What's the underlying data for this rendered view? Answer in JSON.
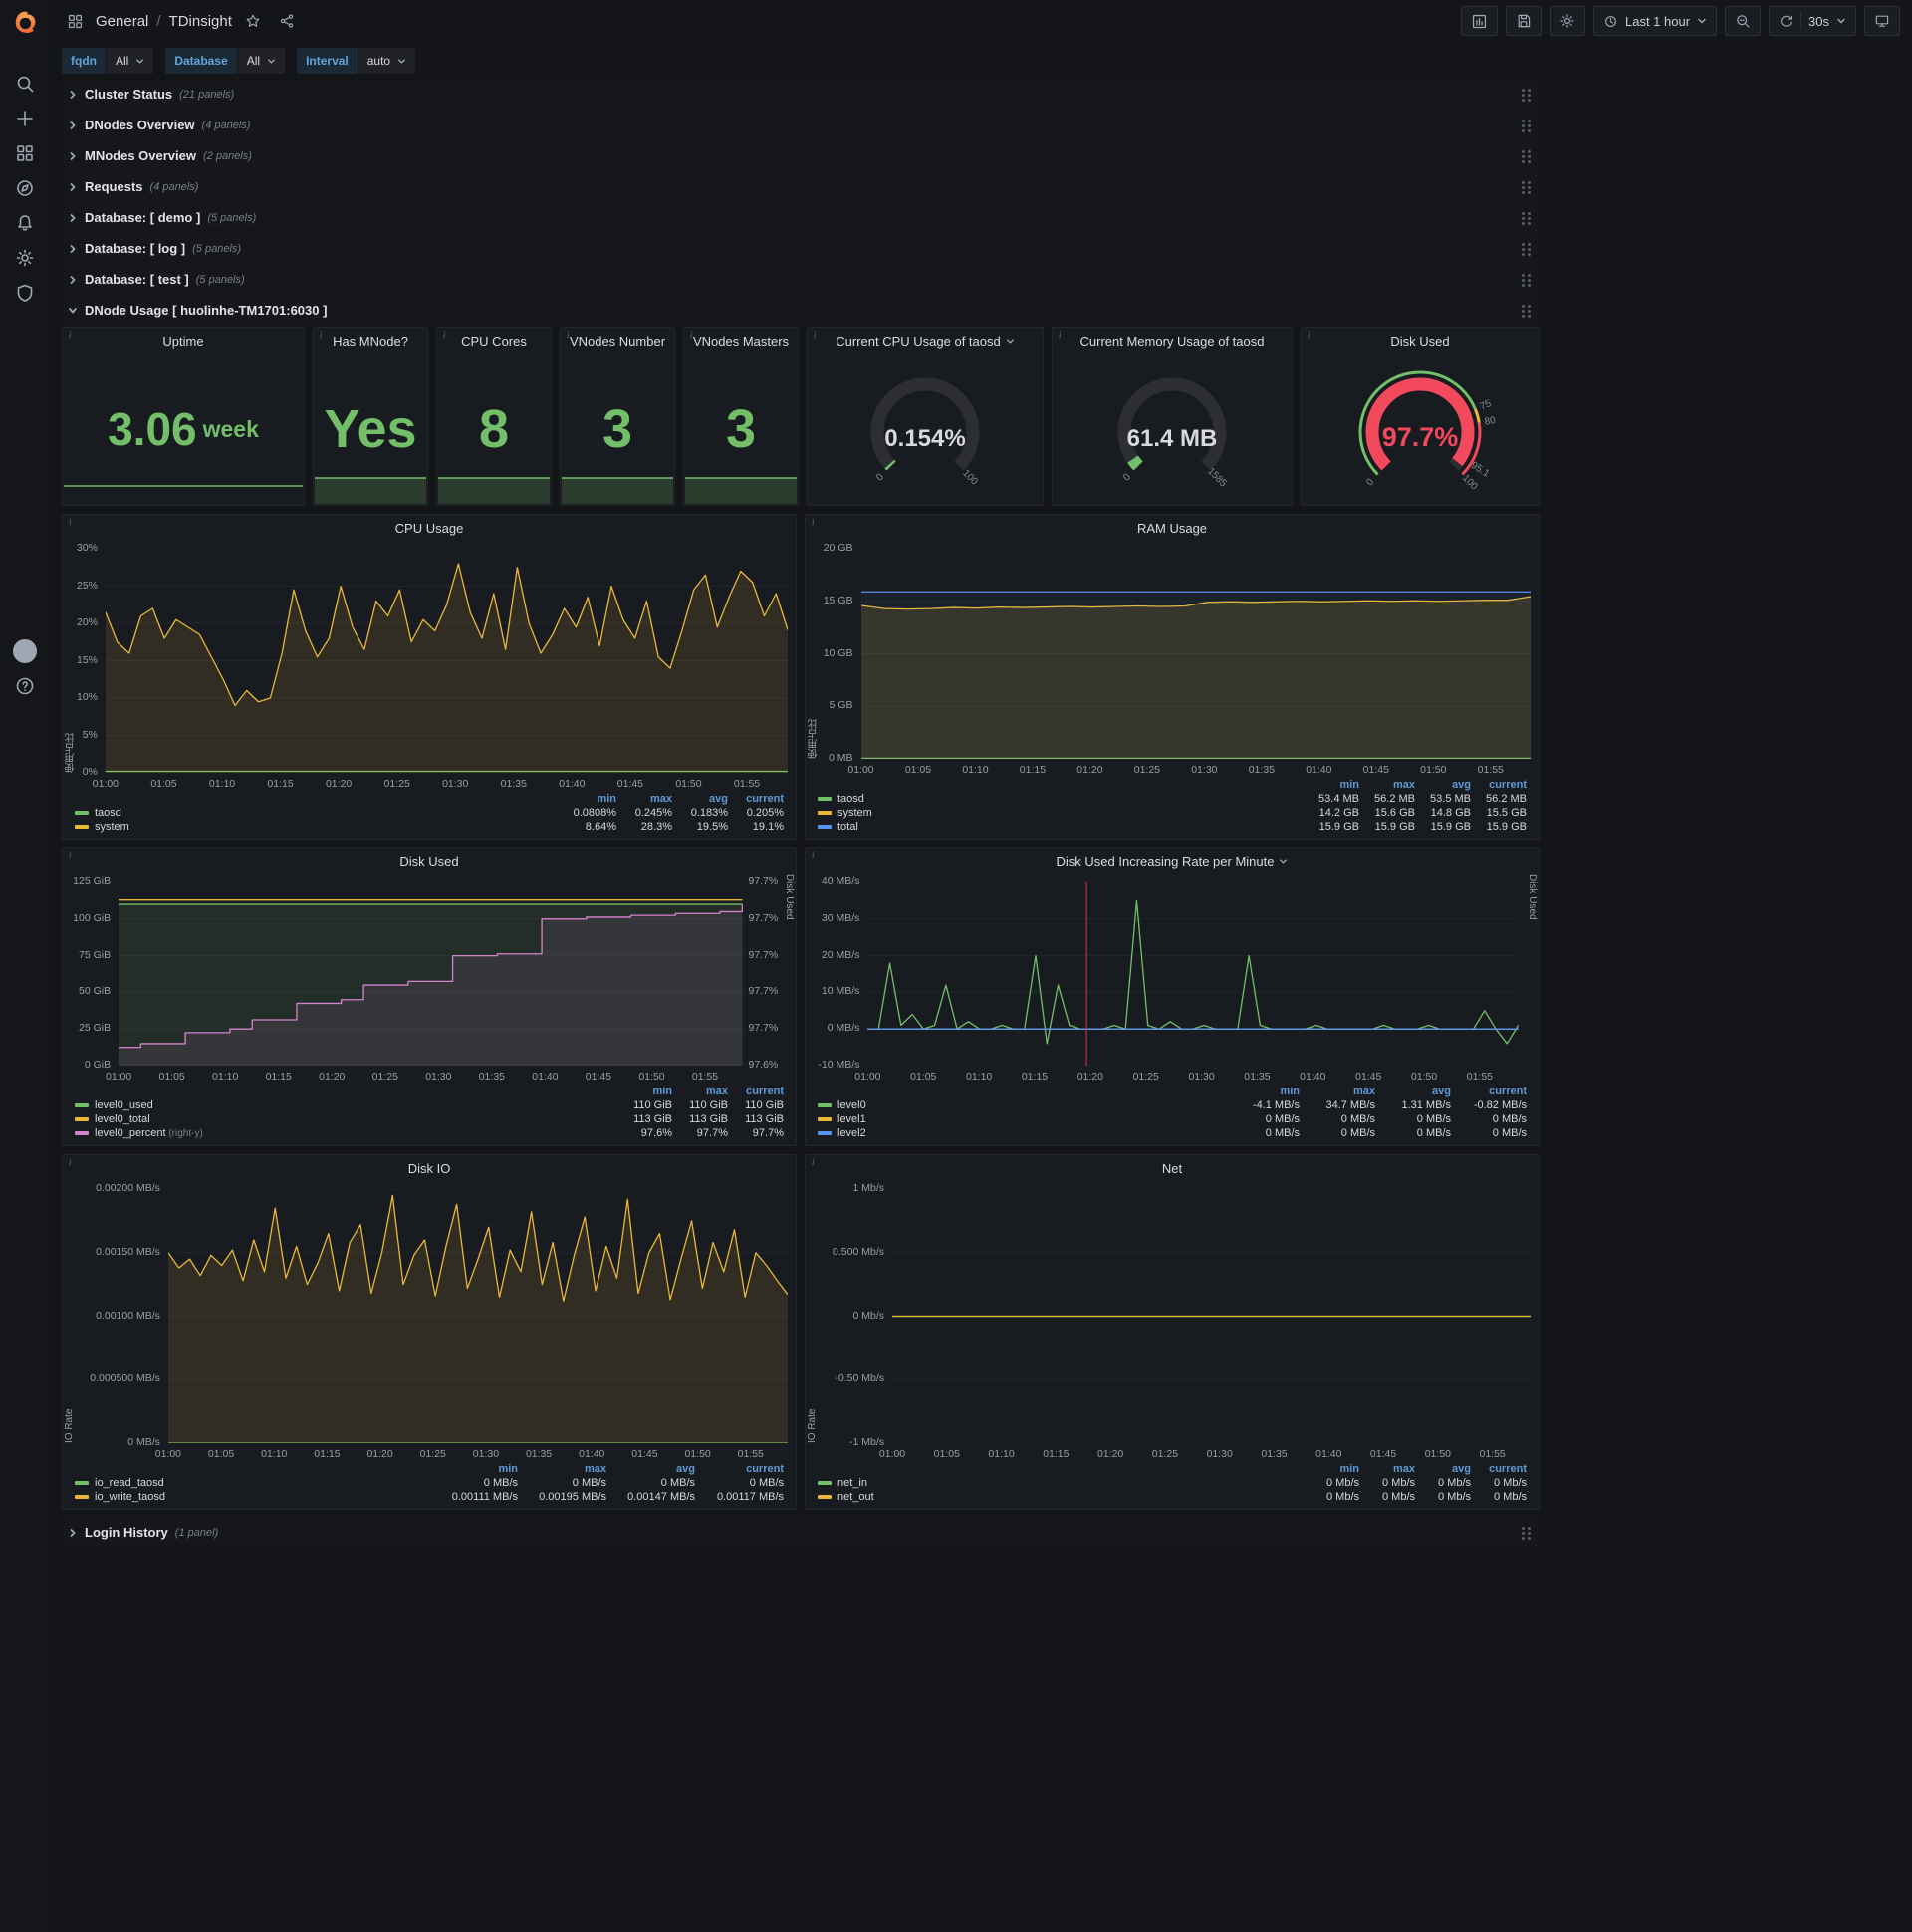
{
  "nav": {
    "section": "General",
    "separator": "/",
    "dashboard": "TDinsight",
    "time_range": "Last 1 hour",
    "refresh": "30s"
  },
  "variables": [
    {
      "label": "fqdn",
      "value": "All"
    },
    {
      "label": "Database",
      "value": "All"
    },
    {
      "label": "Interval",
      "value": "auto"
    }
  ],
  "collapsed_rows": [
    {
      "title": "Cluster Status",
      "count": "(21 panels)"
    },
    {
      "title": "DNodes Overview",
      "count": "(4 panels)"
    },
    {
      "title": "MNodes Overview",
      "count": "(2 panels)"
    },
    {
      "title": "Requests",
      "count": "(4 panels)"
    },
    {
      "title": "Database: [ demo ]",
      "count": "(5 panels)"
    },
    {
      "title": "Database: [ log ]",
      "count": "(5 panels)"
    },
    {
      "title": "Database: [ test ]",
      "count": "(5 panels)"
    }
  ],
  "expanded_row": {
    "title": "DNode Usage [ huolinhe-TM1701:6030 ]"
  },
  "bottom_row": {
    "title": "Login History",
    "count": "(1 panel)"
  },
  "stats": [
    {
      "title": "Uptime",
      "value": "3.06",
      "unit": "week",
      "spark": "line"
    },
    {
      "title": "Has MNode?",
      "value": "Yes",
      "unit": "",
      "spark": "area"
    },
    {
      "title": "CPU Cores",
      "value": "8",
      "unit": "",
      "spark": "area"
    },
    {
      "title": "VNodes Number",
      "value": "3",
      "unit": "",
      "spark": "area"
    },
    {
      "title": "VNodes Masters",
      "value": "3",
      "unit": "",
      "spark": "area"
    }
  ],
  "gauges": [
    {
      "title": "Current CPU Usage of taosd",
      "value": "0.154%",
      "fraction": 0.00154,
      "arc_color": "#73bf69",
      "value_color": "#d8d9da",
      "has_dropdown": true,
      "has_ring": false,
      "scale_labels": [
        {
          "text": "0",
          "f": 0
        },
        {
          "text": "100",
          "f": 1
        }
      ]
    },
    {
      "title": "Current Memory Usage of taosd",
      "value": "61.4 MB",
      "fraction": 0.0387,
      "arc_color": "#73bf69",
      "value_color": "#d8d9da",
      "has_dropdown": false,
      "has_ring": false,
      "scale_labels": [
        {
          "text": "0",
          "f": 0
        },
        {
          "text": "1585",
          "f": 1
        }
      ]
    },
    {
      "title": "Disk Used",
      "value": "97.7%",
      "fraction": 0.977,
      "arc_color": "#f2495c",
      "value_color": "#f2495c",
      "has_dropdown": false,
      "has_ring": true,
      "scale_labels": [
        {
          "text": "0",
          "f": 0
        },
        {
          "text": "75",
          "f": 0.75
        },
        {
          "text": "80",
          "f": 0.8
        },
        {
          "text": "95.1",
          "f": 0.951
        },
        {
          "text": "100",
          "f": 1
        }
      ]
    }
  ],
  "chart_data": [
    {
      "type": "line",
      "title": "CPU Usage",
      "ylabel": "使用占比",
      "yticks": [
        "0%",
        "5%",
        "10%",
        "15%",
        "20%",
        "25%",
        "30%"
      ],
      "ylim": [
        0,
        30
      ],
      "xticks": [
        "01:00",
        "01:05",
        "01:10",
        "01:15",
        "01:20",
        "01:25",
        "01:30",
        "01:35",
        "01:40",
        "01:45",
        "01:50",
        "01:55"
      ],
      "series": [
        {
          "name": "taosd",
          "color": "#73bf69",
          "values": [
            0.2,
            0.2
          ]
        },
        {
          "name": "system",
          "color": "#eab839",
          "fill": 0.12,
          "values": [
            21.5,
            17.5,
            16,
            21,
            22,
            18,
            20.5,
            19.5,
            18.5,
            15.5,
            12.5,
            9,
            11,
            9.5,
            10,
            16,
            24.5,
            19,
            15.5,
            18,
            25,
            19.5,
            16.5,
            23,
            21,
            24.5,
            17.5,
            20.5,
            19,
            22.5,
            28,
            21.5,
            18,
            24,
            16.5,
            27.5,
            20,
            16,
            18.5,
            22,
            19.5,
            23.5,
            17,
            25,
            20.5,
            18,
            23,
            15.5,
            14,
            19,
            24.5,
            26.5,
            19.5,
            23.5,
            27,
            25.5,
            21,
            24,
            19.1
          ]
        }
      ],
      "legend": {
        "columns": [
          "min",
          "max",
          "avg",
          "current"
        ],
        "rows": [
          {
            "name": "taosd",
            "color": "#73bf69",
            "values": [
              "0.0808%",
              "0.245%",
              "0.183%",
              "0.205%"
            ]
          },
          {
            "name": "system",
            "color": "#eab839",
            "values": [
              "8.64%",
              "28.3%",
              "19.5%",
              "19.1%"
            ]
          }
        ]
      }
    },
    {
      "type": "line",
      "title": "RAM Usage",
      "ylabel": "使用占比",
      "yticks": [
        "0 MB",
        "5 GB",
        "10 GB",
        "15 GB",
        "20 GB"
      ],
      "ylim": [
        0,
        20
      ],
      "xticks": [
        "01:00",
        "01:05",
        "01:10",
        "01:15",
        "01:20",
        "01:25",
        "01:30",
        "01:35",
        "01:40",
        "01:45",
        "01:50",
        "01:55"
      ],
      "series": [
        {
          "name": "taosd",
          "color": "#73bf69",
          "values": [
            0.055,
            0.055
          ]
        },
        {
          "name": "system",
          "color": "#eab839",
          "fill": 0.14,
          "values": [
            14.6,
            14.3,
            14.25,
            14.3,
            14.4,
            14.35,
            14.45,
            14.4,
            14.45,
            14.5,
            14.45,
            14.5,
            14.55,
            14.5,
            14.55,
            14.9,
            14.95,
            14.9,
            14.95,
            15,
            14.95,
            15,
            15.05,
            15,
            15.05,
            15,
            15.05,
            15.1,
            15.1,
            15.45
          ]
        },
        {
          "name": "total",
          "color": "#5794f2",
          "fill": 0.05,
          "values": [
            15.9,
            15.9
          ]
        }
      ],
      "legend": {
        "columns": [
          "min",
          "max",
          "avg",
          "current"
        ],
        "rows": [
          {
            "name": "taosd",
            "color": "#73bf69",
            "values": [
              "53.4 MB",
              "56.2 MB",
              "53.5 MB",
              "56.2 MB"
            ]
          },
          {
            "name": "system",
            "color": "#eab839",
            "values": [
              "14.2 GB",
              "15.6 GB",
              "14.8 GB",
              "15.5 GB"
            ]
          },
          {
            "name": "total",
            "color": "#5794f2",
            "values": [
              "15.9 GB",
              "15.9 GB",
              "15.9 GB",
              "15.9 GB"
            ]
          }
        ]
      }
    },
    {
      "type": "line",
      "title": "Disk Used",
      "yticks": [
        "0 GiB",
        "25 GiB",
        "50 GiB",
        "75 GiB",
        "100 GiB",
        "125 GiB"
      ],
      "ylim": [
        0,
        125
      ],
      "yticks_right": [
        "97.6%",
        "97.7%",
        "97.7%",
        "97.7%",
        "97.7%",
        "97.7%"
      ],
      "ylim_right": [
        97.6,
        97.7
      ],
      "ylabel_right": "Disk Used",
      "xticks": [
        "01:00",
        "01:05",
        "01:10",
        "01:15",
        "01:20",
        "01:25",
        "01:30",
        "01:35",
        "01:40",
        "01:45",
        "01:50",
        "01:55"
      ],
      "series": [
        {
          "name": "level0_used",
          "color": "#73bf69",
          "fill": 0.12,
          "values": [
            110,
            110
          ]
        },
        {
          "name": "level0_total",
          "color": "#eab839",
          "values": [
            113,
            113
          ]
        },
        {
          "name": "level0_percent",
          "color": "#d683ce",
          "axis": "right",
          "step": true,
          "fill": 0.1,
          "values": [
            97.61,
            97.612,
            97.612,
            97.618,
            97.618,
            97.62,
            97.625,
            97.625,
            97.634,
            97.634,
            97.636,
            97.644,
            97.644,
            97.646,
            97.646,
            97.66,
            97.66,
            97.661,
            97.661,
            97.68,
            97.68,
            97.681,
            97.681,
            97.682,
            97.682,
            97.683,
            97.683,
            97.684,
            97.688
          ]
        }
      ],
      "legend": {
        "columns": [
          "min",
          "max",
          "current"
        ],
        "rows": [
          {
            "name": "level0_used",
            "color": "#73bf69",
            "values": [
              "110 GiB",
              "110 GiB",
              "110 GiB"
            ]
          },
          {
            "name": "level0_total",
            "color": "#eab839",
            "values": [
              "113 GiB",
              "113 GiB",
              "113 GiB"
            ]
          },
          {
            "name": "level0_percent",
            "suffix": "(right-y)",
            "color": "#d683ce",
            "values": [
              "97.6%",
              "97.7%",
              "97.7%"
            ]
          }
        ]
      }
    },
    {
      "type": "line",
      "title": "Disk Used Increasing Rate per Minute",
      "has_dropdown": true,
      "yticks": [
        "-10 MB/s",
        "0 MB/s",
        "10 MB/s",
        "20 MB/s",
        "30 MB/s",
        "40 MB/s"
      ],
      "ylim": [
        -10,
        40
      ],
      "ylabel_right": "Disk Used",
      "annotation_minute": 19.7,
      "xticks": [
        "01:00",
        "01:05",
        "01:10",
        "01:15",
        "01:20",
        "01:25",
        "01:30",
        "01:35",
        "01:40",
        "01:45",
        "01:50",
        "01:55"
      ],
      "series": [
        {
          "name": "level0",
          "color": "#73bf69",
          "values": [
            0,
            0,
            18,
            1,
            4,
            0,
            1,
            12,
            0,
            2,
            0,
            0,
            1,
            0,
            0,
            20,
            -4,
            12,
            1,
            0,
            0,
            0,
            1,
            0,
            35,
            1,
            0,
            2,
            0,
            0,
            1,
            0,
            0,
            0,
            20,
            1,
            0,
            0,
            0,
            0,
            1,
            0,
            0,
            0,
            0,
            0,
            1,
            0,
            0,
            0,
            1,
            0,
            0,
            0,
            0,
            5,
            0,
            -4,
            1
          ]
        },
        {
          "name": "level1",
          "color": "#eab839",
          "values": [
            0,
            0
          ]
        },
        {
          "name": "level2",
          "color": "#5794f2",
          "values": [
            0,
            0
          ]
        }
      ],
      "legend": {
        "columns": [
          "min",
          "max",
          "avg",
          "current"
        ],
        "rows": [
          {
            "name": "level0",
            "color": "#73bf69",
            "values": [
              "-4.1 MB/s",
              "34.7 MB/s",
              "1.31 MB/s",
              "-0.82 MB/s"
            ]
          },
          {
            "name": "level1",
            "color": "#eab839",
            "values": [
              "0 MB/s",
              "0 MB/s",
              "0 MB/s",
              "0 MB/s"
            ]
          },
          {
            "name": "level2",
            "color": "#5794f2",
            "values": [
              "0 MB/s",
              "0 MB/s",
              "0 MB/s",
              "0 MB/s"
            ]
          }
        ]
      }
    },
    {
      "type": "line",
      "title": "Disk IO",
      "ylabel": "IO Rate",
      "yticks": [
        "0 MB/s",
        "0.000500 MB/s",
        "0.00100 MB/s",
        "0.00150 MB/s",
        "0.00200 MB/s"
      ],
      "ylim": [
        0,
        0.002
      ],
      "xticks": [
        "01:00",
        "01:05",
        "01:10",
        "01:15",
        "01:20",
        "01:25",
        "01:30",
        "01:35",
        "01:40",
        "01:45",
        "01:50",
        "01:55"
      ],
      "series": [
        {
          "name": "io_read_taosd",
          "color": "#73bf69",
          "values": [
            0,
            0
          ]
        },
        {
          "name": "io_write_taosd",
          "color": "#eab839",
          "fill": 0.12,
          "values": [
            0.0015,
            0.00138,
            0.00145,
            0.00132,
            0.00148,
            0.0014,
            0.00152,
            0.00128,
            0.0016,
            0.00135,
            0.00185,
            0.0013,
            0.00155,
            0.00125,
            0.00142,
            0.00165,
            0.0012,
            0.00158,
            0.00172,
            0.00118,
            0.0015,
            0.00195,
            0.00125,
            0.00148,
            0.0016,
            0.00116,
            0.00155,
            0.00188,
            0.00122,
            0.00145,
            0.0017,
            0.00115,
            0.00152,
            0.00135,
            0.00182,
            0.00125,
            0.00158,
            0.00112,
            0.00148,
            0.00178,
            0.0012,
            0.00155,
            0.0013,
            0.00192,
            0.00118,
            0.0015,
            0.00165,
            0.00113,
            0.00145,
            0.00175,
            0.00122,
            0.00158,
            0.00135,
            0.00168,
            0.00115,
            0.0015,
            0.0014,
            0.00128,
            0.00117
          ]
        }
      ],
      "legend": {
        "columns": [
          "min",
          "max",
          "avg",
          "current"
        ],
        "rows": [
          {
            "name": "io_read_taosd",
            "color": "#73bf69",
            "values": [
              "0 MB/s",
              "0 MB/s",
              "0 MB/s",
              "0 MB/s"
            ]
          },
          {
            "name": "io_write_taosd",
            "color": "#eab839",
            "values": [
              "0.00111 MB/s",
              "0.00195 MB/s",
              "0.00147 MB/s",
              "0.00117 MB/s"
            ]
          }
        ]
      }
    },
    {
      "type": "line",
      "title": "Net",
      "ylabel": "IO Rate",
      "yticks": [
        "-1 Mb/s",
        "-0.50 Mb/s",
        "0 Mb/s",
        "0.500 Mb/s",
        "1 Mb/s"
      ],
      "ylim": [
        -1,
        1
      ],
      "xticks": [
        "01:00",
        "01:05",
        "01:10",
        "01:15",
        "01:20",
        "01:25",
        "01:30",
        "01:35",
        "01:40",
        "01:45",
        "01:50",
        "01:55"
      ],
      "series": [
        {
          "name": "net_in",
          "color": "#73bf69",
          "values": [
            0,
            0
          ]
        },
        {
          "name": "net_out",
          "color": "#eab839",
          "values": [
            0,
            0
          ]
        }
      ],
      "legend": {
        "columns": [
          "min",
          "max",
          "avg",
          "current"
        ],
        "rows": [
          {
            "name": "net_in",
            "color": "#73bf69",
            "values": [
              "0 Mb/s",
              "0 Mb/s",
              "0 Mb/s",
              "0 Mb/s"
            ]
          },
          {
            "name": "net_out",
            "color": "#eab839",
            "values": [
              "0 Mb/s",
              "0 Mb/s",
              "0 Mb/s",
              "0 Mb/s"
            ]
          }
        ]
      }
    }
  ]
}
